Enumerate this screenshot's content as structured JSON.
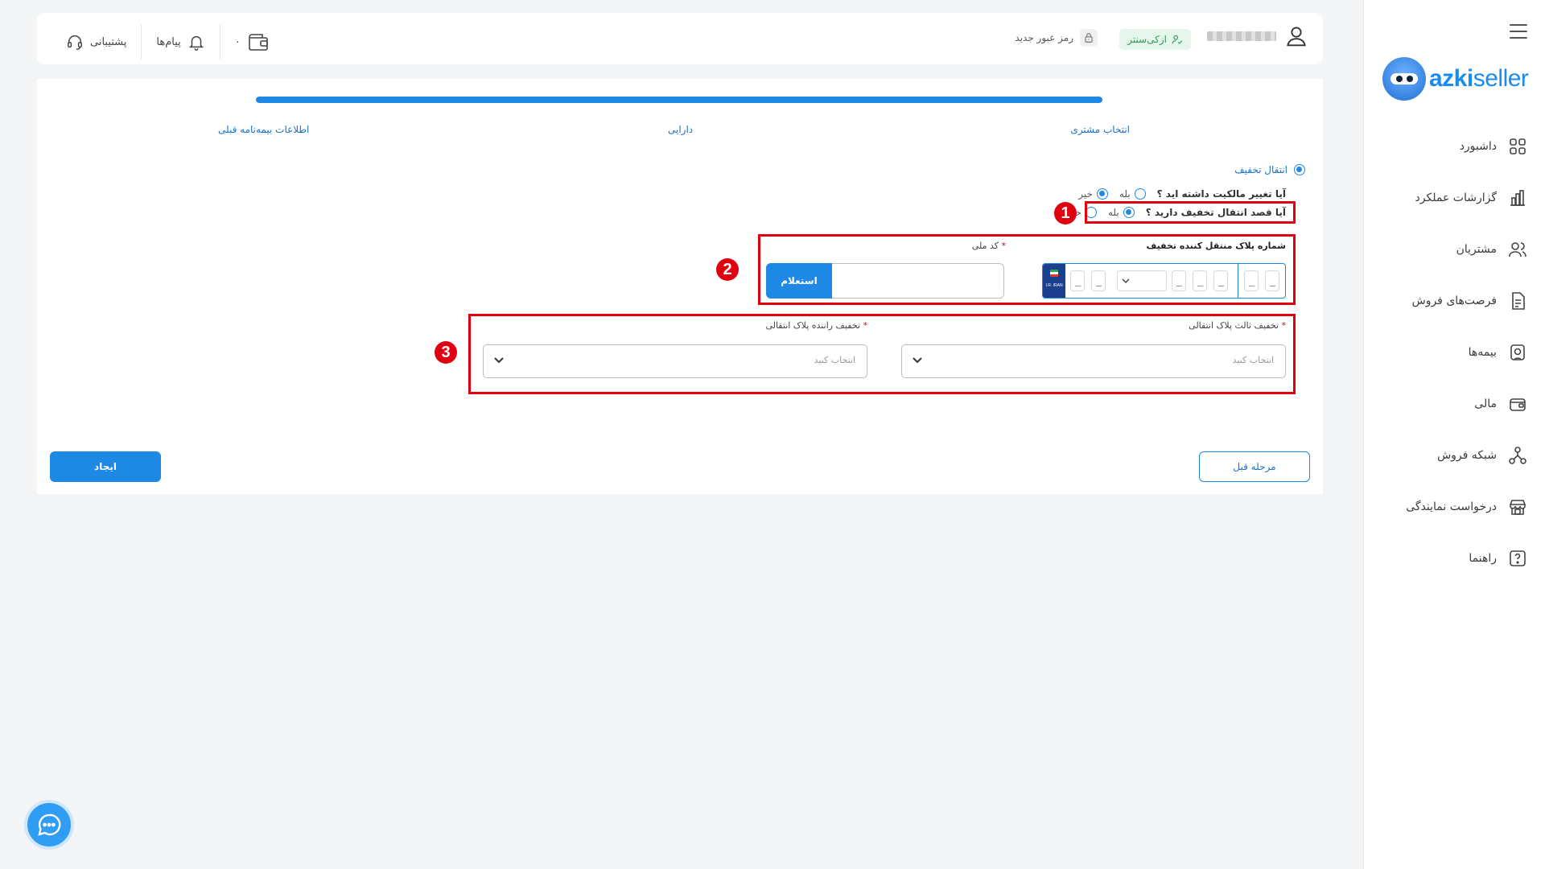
{
  "sidebar": {
    "logo": {
      "part1": "azki",
      "part2": "seller"
    },
    "items": [
      {
        "label": "داشبورد",
        "icon": "dashboard-icon"
      },
      {
        "label": "گزارشات عملکرد",
        "icon": "chart-icon"
      },
      {
        "label": "مشتریان",
        "icon": "users-icon"
      },
      {
        "label": "فرصت‌های فروش",
        "icon": "document-icon"
      },
      {
        "label": "بیمه‌ها",
        "icon": "insurance-icon"
      },
      {
        "label": "مالی",
        "icon": "wallet-icon"
      },
      {
        "label": "شبکه فروش",
        "icon": "network-icon"
      },
      {
        "label": "درخواست نمایندگی",
        "icon": "store-icon"
      },
      {
        "label": "راهنما",
        "icon": "help-icon"
      }
    ]
  },
  "header": {
    "badge": "ازکی‌سنتر",
    "new_password": "رمز عبور جدید",
    "wallet_balance": "۰",
    "messages": "پیام‌ها",
    "support": "پشتیبانی"
  },
  "steps": {
    "progress": 1.0,
    "items": [
      "انتخاب مشتری",
      "دارایی",
      "اطلاعات بیمه‌نامه قبلی"
    ]
  },
  "form": {
    "section_title": "انتقال تخفیف",
    "ownership_question": "آیا تغییر مالکیت داشته اید ؟",
    "transfer_question": "آیا قصد انتقال تخفیف دارید ؟",
    "yes": "بله",
    "no": "خیر",
    "plate_label": "شماره پلاک منتقل کننده تخفیف",
    "plate_flag": "I.R. IRAN",
    "national_id_label": "کد ملی",
    "inquiry_button": "استعلام",
    "third_party_label": "تخفیف ثالث پلاک انتقالی",
    "driver_label": "تخفیف راننده پلاک انتقالی",
    "select_placeholder": "انتخاب کنید",
    "required_mark": "*"
  },
  "markers": [
    "1",
    "2",
    "3"
  ],
  "actions": {
    "prev": "مرحله قبل",
    "create": "ایجاد"
  },
  "colors": {
    "primary": "#1e88e5",
    "annotation": "#e10010",
    "badge_bg": "#e7f6ec"
  }
}
